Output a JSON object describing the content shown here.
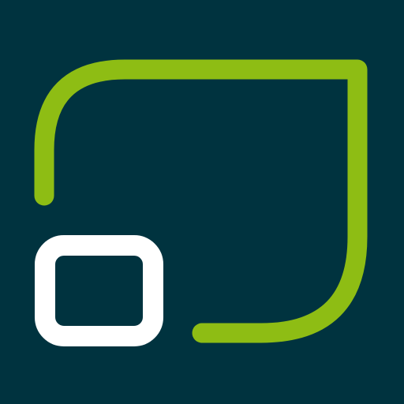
{
  "icon": {
    "semantic": "picture-in-picture-logo",
    "parts": [
      "background",
      "outer-frame-icon",
      "inner-window-icon"
    ]
  },
  "colors": {
    "background": "#00333f",
    "frame": "#8ebd14",
    "window": "#ffffff"
  }
}
